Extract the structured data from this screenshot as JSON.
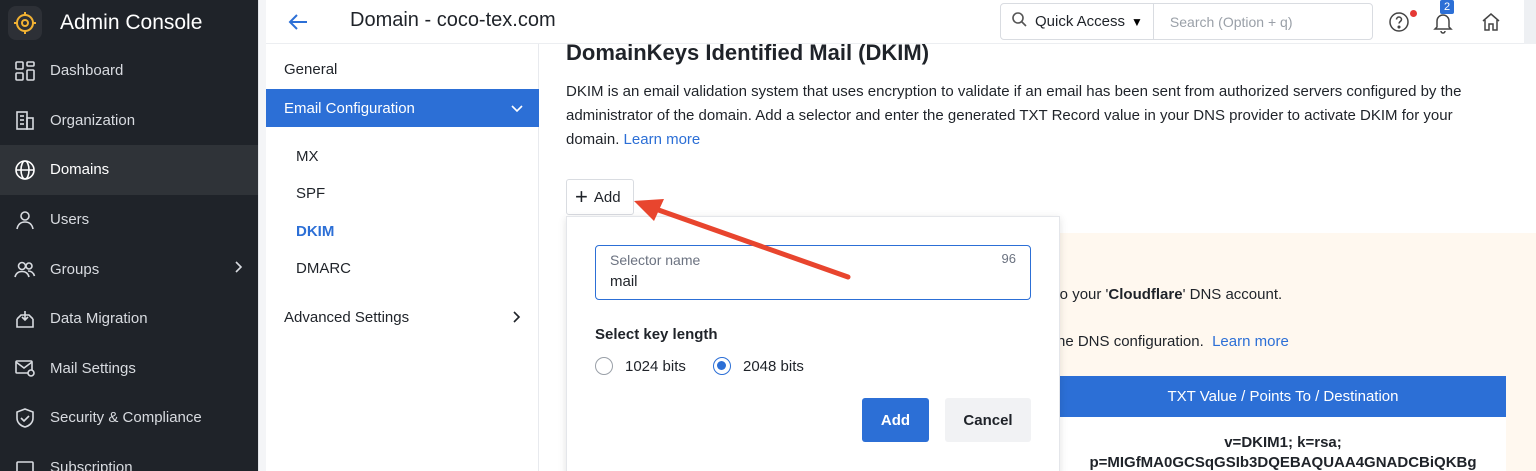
{
  "app": {
    "title": "Admin Console"
  },
  "leftnav": {
    "items": [
      {
        "label": "Dashboard",
        "icon": "dashboard-icon"
      },
      {
        "label": "Organization",
        "icon": "building-icon"
      },
      {
        "label": "Domains",
        "icon": "globe-icon",
        "active": true
      },
      {
        "label": "Users",
        "icon": "user-icon"
      },
      {
        "label": "Groups",
        "icon": "group-icon",
        "has_chevron": true
      },
      {
        "label": "Data Migration",
        "icon": "migration-icon"
      },
      {
        "label": "Mail Settings",
        "icon": "mail-settings-icon"
      },
      {
        "label": "Security & Compliance",
        "icon": "shield-icon"
      },
      {
        "label": "Subscription",
        "icon": "subscription-icon"
      }
    ]
  },
  "header": {
    "title": "Domain - coco-tex.com",
    "quick_access": "Quick Access",
    "search_placeholder": "Search (Option + q)",
    "notification_count": "2"
  },
  "submenu": {
    "general": "General",
    "email_configuration": "Email Configuration",
    "sub_items": [
      "MX",
      "SPF",
      "DKIM",
      "DMARC"
    ],
    "selected": "DKIM",
    "advanced": "Advanced Settings"
  },
  "main": {
    "title": "DomainKeys Identified Mail (DKIM)",
    "description": "DKIM is an email validation system that uses encryption to validate if an email has been sent from authorized servers configured by the administrator of the domain. Add a selector and enter the generated TXT Record value in your DNS provider to activate DKIM for your domain.",
    "learn_more": "Learn more",
    "add_button": "Add",
    "bg_line1_link": "n",
    "bg_line1_pre": " to your '",
    "bg_line1_bold": "Cloudflare",
    "bg_line1_post": "' DNS account.",
    "bg_line2": "he DNS configuration.",
    "bg_line2_link": "Learn more",
    "table_header": "TXT Value / Points To / Destination",
    "table_cell_1": "v=DKIM1; k=rsa;",
    "table_cell_2": "p=MIGfMA0GCSqGSIb3DQEBAQUAA4GNADCBiQKBg"
  },
  "popup": {
    "selector_label": "Selector name",
    "selector_count": "96",
    "selector_value": "mail",
    "key_length_label": "Select key length",
    "options": [
      "1024 bits",
      "2048 bits"
    ],
    "selected_option": "2048 bits",
    "add_label": "Add",
    "cancel_label": "Cancel"
  },
  "colors": {
    "accent": "#2c6fd6",
    "nav_bg": "#1f2329",
    "annotation_arrow": "#e8452e"
  }
}
